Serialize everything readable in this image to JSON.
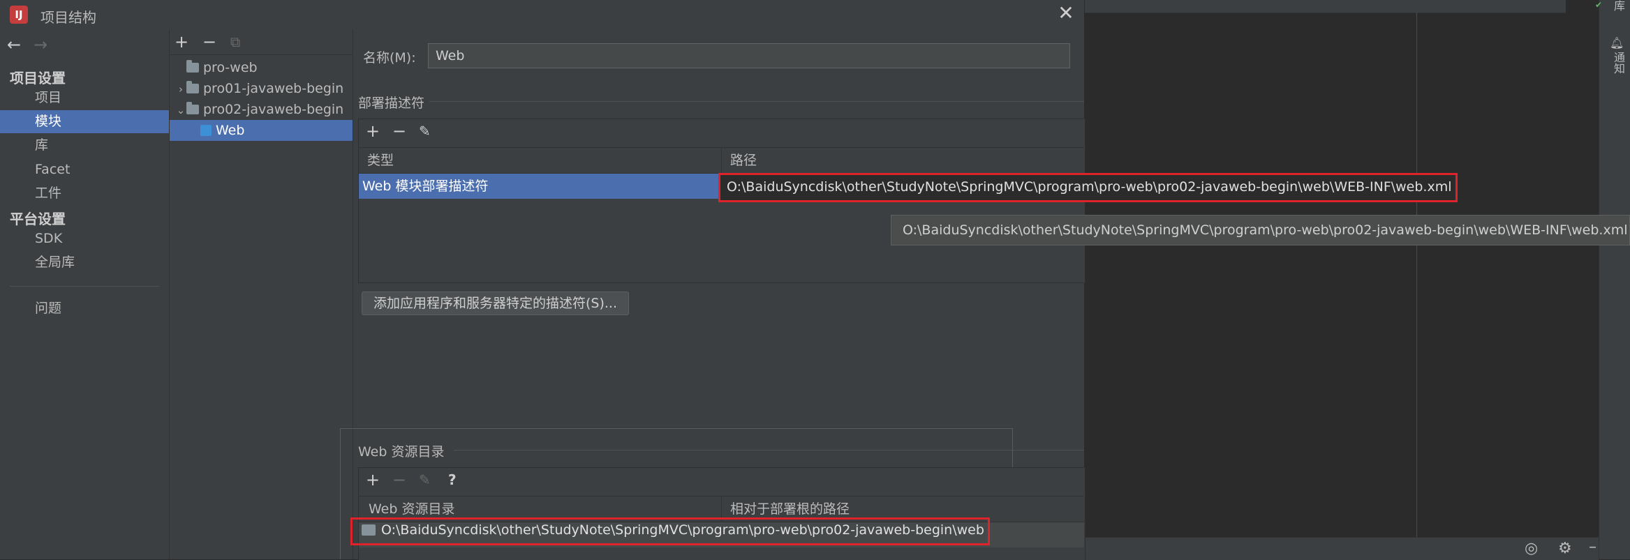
{
  "dialog": {
    "title": "项目结构",
    "app_icon_text": "IJ",
    "close_icon": "close-icon"
  },
  "nav": {
    "back_icon": "arrow-left-icon",
    "forward_icon": "arrow-right-icon",
    "project_settings_header": "项目设置",
    "project_settings_items": [
      "项目",
      "模块",
      "库",
      "Facet",
      "工件"
    ],
    "selected_item": "模块",
    "platform_settings_header": "平台设置",
    "platform_settings_items": [
      "SDK",
      "全局库"
    ],
    "problems": "问题"
  },
  "tree": {
    "toolbar": [
      "add-icon",
      "remove-icon",
      "copy-icon"
    ],
    "items": [
      {
        "label": "pro-web",
        "type": "folder"
      },
      {
        "label": "pro01-javaweb-begin",
        "type": "folder",
        "expanded": false
      },
      {
        "label": "pro02-javaweb-begin",
        "type": "folder",
        "expanded": true
      },
      {
        "label": "Web",
        "type": "web-facet",
        "selected": true
      }
    ],
    "toggle_collapsed": "›",
    "toggle_expanded": "⌄"
  },
  "main": {
    "name_label": "名称(M):",
    "name_value": "Web",
    "deployment": {
      "title": "部署描述符",
      "toolbar": [
        "add-icon",
        "remove-icon",
        "edit-icon"
      ],
      "col_type": "类型",
      "col_path": "路径",
      "rows": [
        {
          "type": "Web 模块部署描述符",
          "path": "O:\\BaiduSyncdisk\\other\\StudyNote\\SpringMVC\\program\\pro-web\\pro02-javaweb-begin\\web\\WEB-INF\\web.xml"
        }
      ],
      "tooltip": "O:\\BaiduSyncdisk\\other\\StudyNote\\SpringMVC\\program\\pro-web\\pro02-javaweb-begin\\web\\WEB-INF\\web.xml",
      "add_button": "添加应用程序和服务器特定的描述符(S)..."
    },
    "web_resources": {
      "title": "Web 资源目录",
      "toolbar": [
        "add-icon",
        "remove-icon",
        "edit-icon",
        "help-icon"
      ],
      "col_dir": "Web 资源目录",
      "col_rel": "相对于部署根的路径",
      "rows": [
        {
          "dir": "O:\\BaiduSyncdisk\\other\\StudyNote\\SpringMVC\\program\\pro-web\\pro02-javaweb-begin\\web",
          "rel": ""
        }
      ]
    }
  },
  "ide": {
    "right_tabs": [
      "库",
      "通知"
    ],
    "status_icons": [
      "target-icon",
      "gear-icon",
      "minimize-icon"
    ]
  },
  "colors": {
    "selection": "#4b6eaf",
    "highlight_border": "#e0222b",
    "panel_bg": "#3c3f41",
    "editor_bg": "#2b2b2b"
  }
}
